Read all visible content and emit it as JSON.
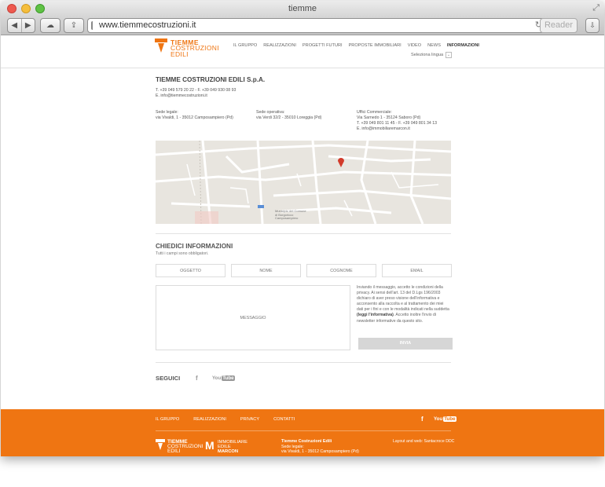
{
  "window": {
    "title": "tiemme"
  },
  "browser": {
    "url": "www.tiemmecostruzioni.it",
    "reader_label": "Reader",
    "back_glyph": "◀",
    "forward_glyph": "▶",
    "reload_glyph": "↻",
    "cloud_glyph": "☁",
    "share_glyph": "⇪",
    "download_glyph": "⇩",
    "fullscreen_glyph": "⤢"
  },
  "header": {
    "logo": {
      "line1": "TIEMME",
      "line2": "COSTRUZIONI",
      "line3": "EDILI"
    },
    "nav": [
      "IL GRUPPO",
      "REALIZZAZIONI",
      "PROGETTI FUTURI",
      "PROPOSTE IMMOBILIARI",
      "VIDEO",
      "NEWS",
      "INFORMAZIONI"
    ],
    "active_nav": "INFORMAZIONI",
    "language_label": "Seleziona lingua",
    "language_glyph": "⌄"
  },
  "company": {
    "name": "TIEMME COSTRUZIONI EDILI S.p.A.",
    "phone_fax": "T. +39 049 579 20 22  -  F. +39 049 930 08 93",
    "email": "E. info@tiemmecostruzioni.it",
    "addresses": [
      {
        "line1": "Sede legale:",
        "line2": "via Vivaldi, 1  -  35012 Camposampiero (Pd)",
        "line3": "",
        "line4": ""
      },
      {
        "line1": "Sede operativa:",
        "line2": "via Verdi 32/2  -  35010 Loreggia (Pd)",
        "line3": "",
        "line4": ""
      },
      {
        "line1": "Uffici Commerciale:",
        "line2": "Via Sarnedo 1  -  35124 Saboro (Pd)",
        "line3": "T. +39 049 801 11 45  -  F. +39 049 801 34 13",
        "line4": "E. info@immobiliaremarcon.it"
      }
    ]
  },
  "map": {
    "labels": [
      "Municipio del Comune di Borgoricco Camposampiero"
    ],
    "marker_color": "#d23a2a"
  },
  "form": {
    "title": "CHIEDICI INFORMAZIONI",
    "subtitle": "Tutti i campi sono obbligatori.",
    "fields": {
      "oggetto": "OGGETTO",
      "nome": "NOME",
      "cognome": "COGNOME",
      "email": "EMAIL",
      "messaggio": "MESSAGGIO"
    },
    "privacy_text_1": "Inviando il messaggio, accetto le condizioni della privacy. Ai sensi dell'art. 13 del D.Lgs 196/2003 dichiaro di aver preso visione dell'informativa e acconsento alla raccolta e al trattamento dei miei dati per i fini e con le modalità indicati nella suddetta",
    "privacy_link": "(leggi l'informativa)",
    "privacy_text_2": ". Accetto inoltre l'invio di newsletter informative da questo sito.",
    "send_label": "INVIA"
  },
  "social": {
    "label": "SEGUICI",
    "facebook_glyph": "f",
    "youtube_you": "You",
    "youtube_tube": "Tube"
  },
  "footer": {
    "nav": [
      "IL GRUPPO",
      "REALIZZAZIONI",
      "PRIVACY",
      "CONTATTI"
    ],
    "logo1": {
      "line1": "TIEMME",
      "line2": "COSTRUZIONI",
      "line3": "EDILI"
    },
    "logo2": {
      "mark": "M",
      "line1": "IMMOBILIARE",
      "line2": "EDILE",
      "line3": "MARCON"
    },
    "info_title": "Tiemme Costruzioni Edili",
    "info_line1": "Sede legale:",
    "info_line2": "via Vivaldi, 1  -  35012 Camposampiero (Pd)",
    "credit": "Layout and web: Santacroce DDC",
    "accent": "#ef7512"
  }
}
